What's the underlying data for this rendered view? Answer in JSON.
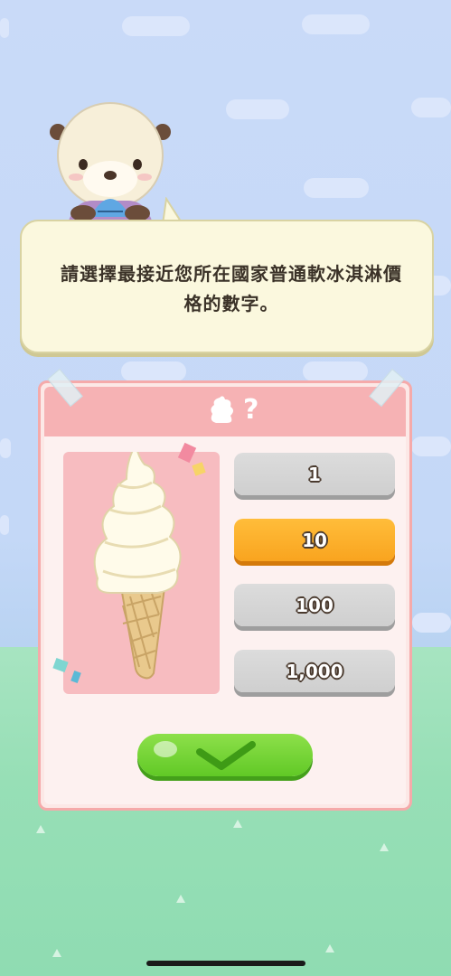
{
  "prompt": {
    "text": "請選擇最接近您所在國家普通軟冰淇淋價格的數字。"
  },
  "card": {
    "header_mark": "?",
    "image": "soft-serve-ice-cream-cone"
  },
  "options": [
    {
      "label": "1",
      "selected": false
    },
    {
      "label": "10",
      "selected": true
    },
    {
      "label": "100",
      "selected": false
    },
    {
      "label": "1,000",
      "selected": false
    }
  ],
  "confirm": {
    "icon": "checkmark-icon"
  },
  "colors": {
    "selected_option": "#f9a41f",
    "unselected_option": "#d5d5d5",
    "confirm_button": "#6ed033",
    "card_border": "#f5aaaa"
  }
}
